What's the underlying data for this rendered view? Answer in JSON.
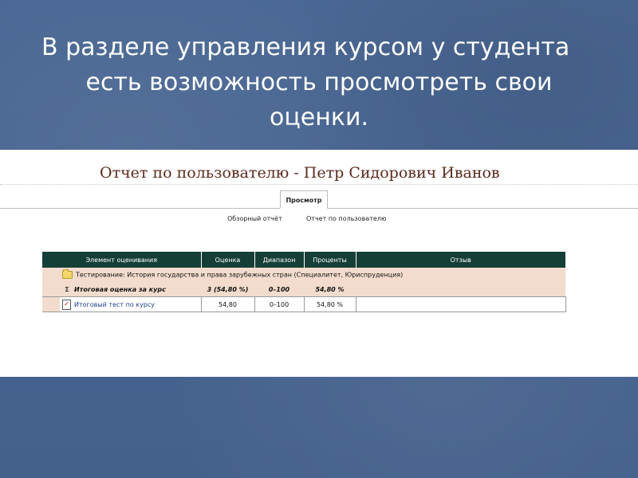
{
  "slide": {
    "line1": "В разделе управления курсом у студента",
    "line2": "есть возможность просмотреть свои",
    "line3": "оценки."
  },
  "report": {
    "title": "Отчет по пользователю - Петр Сидорович Иванов",
    "tab": "Просмотр",
    "subtabs": [
      "Обзорный отчёт",
      "Отчет по пользователю"
    ]
  },
  "table": {
    "headers": [
      "Элемент оценивания",
      "Оценка",
      "Диапазон",
      "Проценты",
      "Отзыв"
    ],
    "category": "Тестирование: История государства и права зарубежных стран (Специалитет, Юриспруденция)",
    "total": {
      "name": "Итоговая оценка за курс",
      "grade": "3 (54,80 %)",
      "range": "0–100",
      "percent": "54,80 %",
      "feedback": ""
    },
    "item": {
      "name": "Итоговый тест по курсу",
      "grade": "54,80",
      "range": "0–100",
      "percent": "54,80 %",
      "feedback": ""
    }
  },
  "icons": {
    "category": "folder-icon",
    "total": "sigma-icon",
    "item": "quiz-icon"
  }
}
